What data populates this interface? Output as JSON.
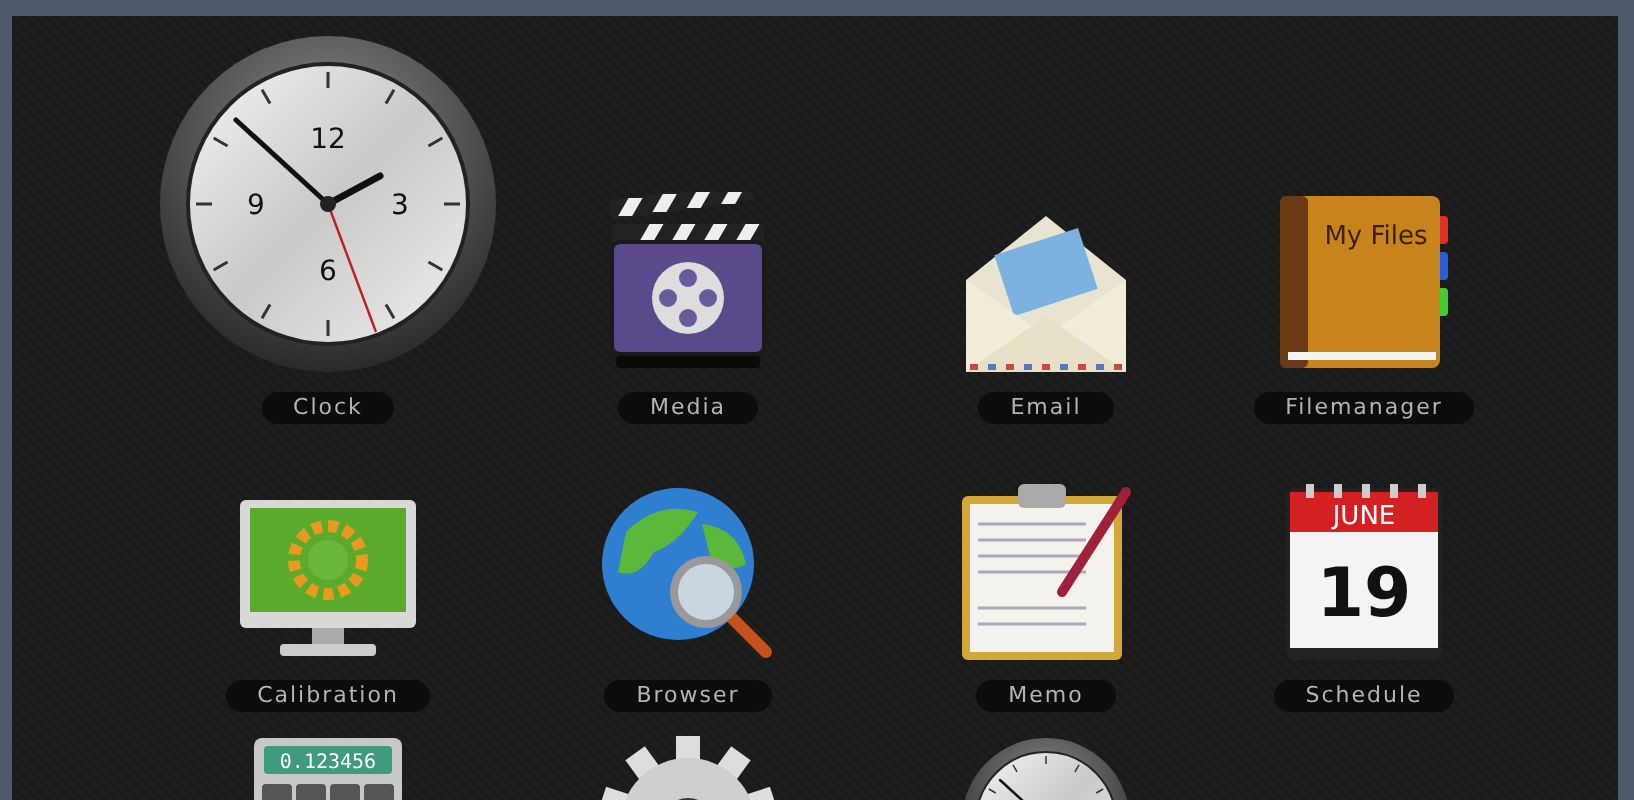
{
  "apps": [
    {
      "kind": "clock",
      "label": "Clock",
      "numerals": [
        "12",
        "3",
        "6",
        "9"
      ]
    },
    {
      "kind": "media",
      "label": "Media"
    },
    {
      "kind": "email",
      "label": "Email"
    },
    {
      "kind": "files",
      "label": "Filemanager",
      "cover_text": "My Files"
    },
    {
      "kind": "monitor",
      "label": "Calibration"
    },
    {
      "kind": "globe",
      "label": "Browser"
    },
    {
      "kind": "memo",
      "label": "Memo"
    },
    {
      "kind": "calendar",
      "label": "Schedule",
      "month": "JUNE",
      "day": "19"
    },
    {
      "kind": "calculator",
      "display": "0.123456"
    },
    {
      "kind": "gear"
    },
    {
      "kind": "small-clock"
    }
  ]
}
